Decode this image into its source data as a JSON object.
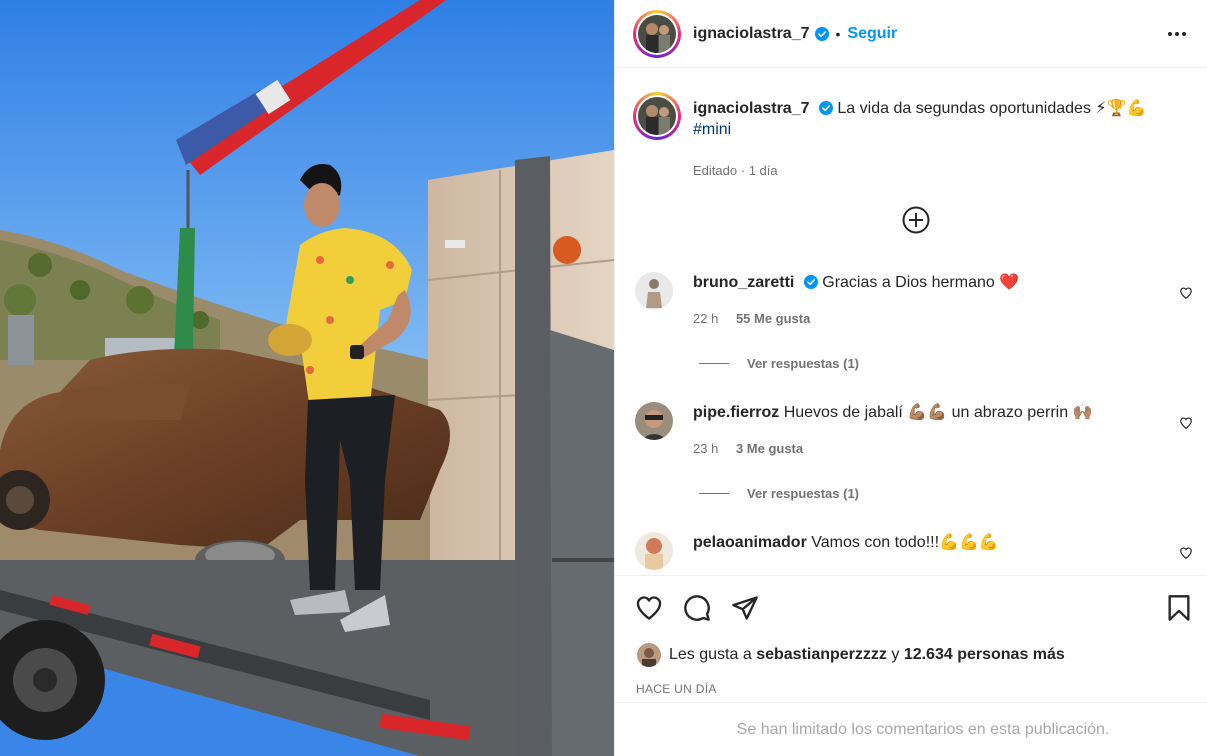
{
  "post": {
    "author": "ignaciolastra_7",
    "follow_label": "Seguir",
    "separator": "•",
    "caption_text": "La vida da segundas oportunidades ⚡🏆💪",
    "hashtag": "#mini",
    "edited_label": "Editado",
    "edited_sep": "·",
    "edited_time": "1 día"
  },
  "comments": [
    {
      "user": "bruno_zaretti",
      "verified": true,
      "text": "Gracias a Dios hermano ❤️",
      "time": "22 h",
      "likes": "55 Me gusta",
      "replies": "Ver respuestas (1)"
    },
    {
      "user": "pipe.fierroz",
      "verified": false,
      "text": "Huevos de jabalí 💪🏽💪🏽 un abrazo perrin 🙌🏽",
      "time": "23 h",
      "likes": "3 Me gusta",
      "replies": "Ver respuestas (1)"
    },
    {
      "user": "pelaoanimador",
      "verified": false,
      "text": "Vamos con todo!!!💪💪💪"
    }
  ],
  "likes": {
    "prefix": "Les gusta a",
    "user": "sebastianperzzzz",
    "conj": "y",
    "others": "12.634 personas más"
  },
  "timestamp": "HACE UN DÍA",
  "limited_notice": "Se han limitado los comentarios en esta publicación.",
  "icons": [
    "verified-badge-icon",
    "more-options-icon",
    "add-comment-icon",
    "heart-icon",
    "comment-icon",
    "share-icon",
    "bookmark-icon"
  ],
  "colors": {
    "link": "#0095f6",
    "verified": "#0095f6",
    "secondary": "#737373",
    "text": "#262626"
  }
}
